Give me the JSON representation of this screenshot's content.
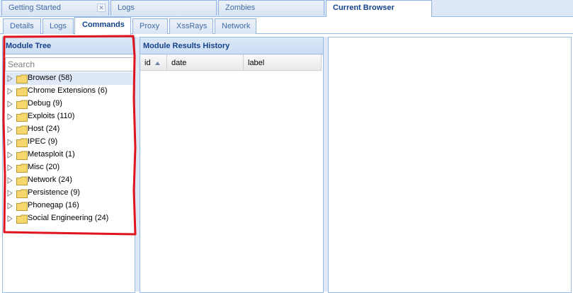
{
  "top_tabs": [
    {
      "label": "Getting Started",
      "closable": true,
      "active": false
    },
    {
      "label": "Logs",
      "closable": false,
      "active": false
    },
    {
      "label": "Zombies",
      "closable": false,
      "active": false
    },
    {
      "label": "Current Browser",
      "closable": false,
      "active": true
    }
  ],
  "sub_tabs": [
    {
      "label": "Details",
      "active": false
    },
    {
      "label": "Logs",
      "active": false
    },
    {
      "label": "Commands",
      "active": true
    },
    {
      "label": "Proxy",
      "active": false
    },
    {
      "label": "XssRays",
      "active": false
    },
    {
      "label": "Network",
      "active": false
    }
  ],
  "module_tree": {
    "title": "Module Tree",
    "search_placeholder": "Search",
    "items": [
      {
        "label": "Browser (58)"
      },
      {
        "label": "Chrome Extensions (6)"
      },
      {
        "label": "Debug (9)"
      },
      {
        "label": "Exploits (110)"
      },
      {
        "label": "Host (24)"
      },
      {
        "label": "IPEC (9)"
      },
      {
        "label": "Metasploit (1)"
      },
      {
        "label": "Misc (20)"
      },
      {
        "label": "Network (24)"
      },
      {
        "label": "Persistence (9)"
      },
      {
        "label": "Phonegap (16)"
      },
      {
        "label": "Social Engineering (24)"
      }
    ]
  },
  "results_history": {
    "title": "Module Results History",
    "columns": [
      "id",
      "date",
      "label"
    ],
    "sort_column": "id",
    "sort_direction": "ascending"
  },
  "colors": {
    "header_text": "#15428b",
    "border": "#99bbe8",
    "highlight_annotation": "#e0141e",
    "folder": "#f5d76e"
  }
}
